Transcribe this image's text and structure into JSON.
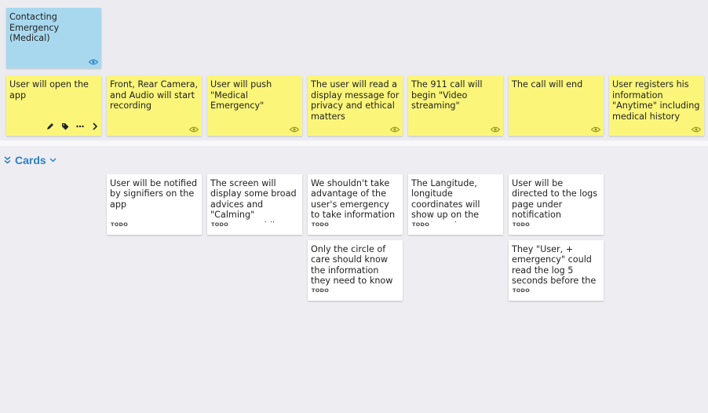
{
  "top_notes": {
    "blue": {
      "text": "Contacting Emergency (Medical)"
    },
    "yellow": [
      {
        "text": "User will open the app"
      },
      {
        "text": "Front, Rear Camera, and Audio will start recording"
      },
      {
        "text": "User will push \"Medical Emergency\""
      },
      {
        "text": "The user will read a display message for privacy and ethical matters"
      },
      {
        "text": "The 911 call will begin \"Video streaming\""
      },
      {
        "text": "The call will end"
      },
      {
        "text": "User registers his information \"Anytime\" including medical history"
      }
    ],
    "tool_icons": [
      "pencil-icon",
      "tag-icon",
      "more-icon",
      "chevron-right-icon"
    ],
    "colors": {
      "blue_note": "#a8d8ee",
      "yellow_note": "#fbf67a",
      "eye_icon_blue": "#2a7fc9",
      "eye_icon_yellow": "#9a9a20"
    }
  },
  "section": {
    "title": "Cards",
    "accent": "#2a7fc9"
  },
  "cards": [
    {
      "text": "User will be notified by signifiers on the app",
      "status": "TODO"
    },
    {
      "text": "The screen will display some broad advices and \"Calming\" messages while",
      "status": "TODO"
    },
    {
      "text": "We shouldn't take advantage of the user's emergency to take information",
      "status": "TODO"
    },
    {
      "text": "Only the circle of care should know the information they need to know",
      "status": "TODO"
    },
    {
      "text": "The Langitude, longitude coordinates will show up on the user's end",
      "status": "TODO"
    },
    {
      "text": "User will be directed to the logs page under notification",
      "status": "TODO"
    },
    {
      "text": "They \"User, + emergency\" could read the log 5 seconds before the",
      "status": "TODO"
    }
  ]
}
